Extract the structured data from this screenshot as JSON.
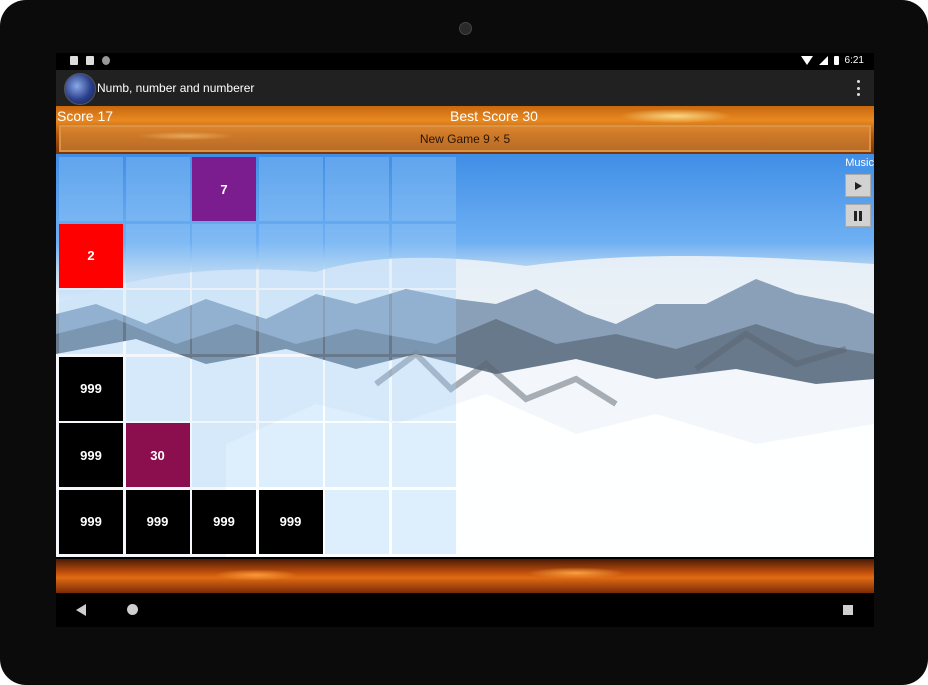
{
  "status_bar": {
    "time": "6:21"
  },
  "app_bar": {
    "title": "Numb, number and numberer"
  },
  "scores": {
    "score_label": "Score 17",
    "best_label": "Best Score 30"
  },
  "new_game": {
    "label": "New Game 9 × 5"
  },
  "board": {
    "rows": 6,
    "columns": 6,
    "tiles": [
      {
        "row": 0,
        "col": 2,
        "value": "7",
        "color": "#7b1d8e"
      },
      {
        "row": 1,
        "col": 0,
        "value": "2",
        "color": "#ff0000"
      },
      {
        "row": 3,
        "col": 0,
        "value": "999",
        "color": "#000000"
      },
      {
        "row": 4,
        "col": 0,
        "value": "999",
        "color": "#000000"
      },
      {
        "row": 4,
        "col": 1,
        "value": "30",
        "color": "#8b0f4e"
      },
      {
        "row": 5,
        "col": 0,
        "value": "999",
        "color": "#000000"
      },
      {
        "row": 5,
        "col": 1,
        "value": "999",
        "color": "#000000"
      },
      {
        "row": 5,
        "col": 2,
        "value": "999",
        "color": "#000000"
      },
      {
        "row": 5,
        "col": 3,
        "value": "999",
        "color": "#000000"
      }
    ]
  },
  "music": {
    "label": "Music",
    "play_icon": "play-icon",
    "pause_icon": "pause-icon"
  },
  "colors": {
    "app_bar": "#212121",
    "score_bar": "#e88a21"
  }
}
